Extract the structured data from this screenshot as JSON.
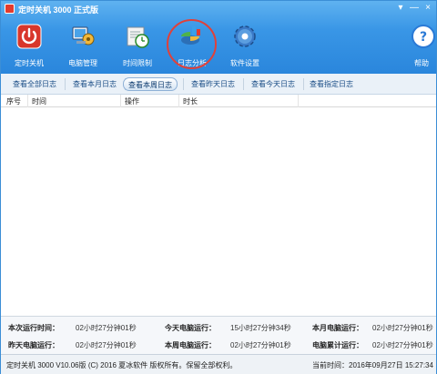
{
  "window": {
    "title": "定时关机 3000 正式版",
    "controls": {
      "minimize": "▾",
      "maximize": "—",
      "close": "×"
    }
  },
  "toolbar": {
    "items": [
      {
        "label": "定时关机",
        "icon": "power-icon"
      },
      {
        "label": "电脑管理",
        "icon": "computer-manage-icon"
      },
      {
        "label": "时间限制",
        "icon": "clock-limit-icon"
      },
      {
        "label": "日志分析",
        "icon": "log-analysis-icon"
      },
      {
        "label": "软件设置",
        "icon": "gear-icon"
      },
      {
        "label": "帮助",
        "icon": "help-icon"
      }
    ]
  },
  "tabs": [
    {
      "label": "查看全部日志",
      "active": false
    },
    {
      "label": "查看本月日志",
      "active": false
    },
    {
      "label": "查看本周日志",
      "active": true
    },
    {
      "label": "查看昨天日志",
      "active": false
    },
    {
      "label": "查看今天日志",
      "active": false
    },
    {
      "label": "查看指定日志",
      "active": false
    }
  ],
  "table": {
    "columns": [
      "序号",
      "时间",
      "操作",
      "时长"
    ],
    "rows": []
  },
  "stats": {
    "this_run": {
      "label": "本次运行时间：",
      "value": "02小时27分钟01秒"
    },
    "today_run": {
      "label": "今天电脑运行：",
      "value": "15小时27分钟34秒"
    },
    "month_run": {
      "label": "本月电脑运行：",
      "value": "02小时27分钟01秒"
    },
    "yesterday_run": {
      "label": "昨天电脑运行：",
      "value": "02小时27分钟01秒"
    },
    "week_run": {
      "label": "本周电脑运行：",
      "value": "02小时27分钟01秒"
    },
    "total_run": {
      "label": "电脑累计运行：",
      "value": "02小时27分钟01秒"
    }
  },
  "status": {
    "left": "定时关机 3000 V10.06版 (C) 2016  夏冰软件 版权所有。保留全部权利。",
    "right": "当前时间：2016年09月27日 15:27:34"
  },
  "colors": {
    "header_blue": "#3996e6",
    "highlight_red": "#e0413a",
    "tab_text": "#1a4d86"
  }
}
